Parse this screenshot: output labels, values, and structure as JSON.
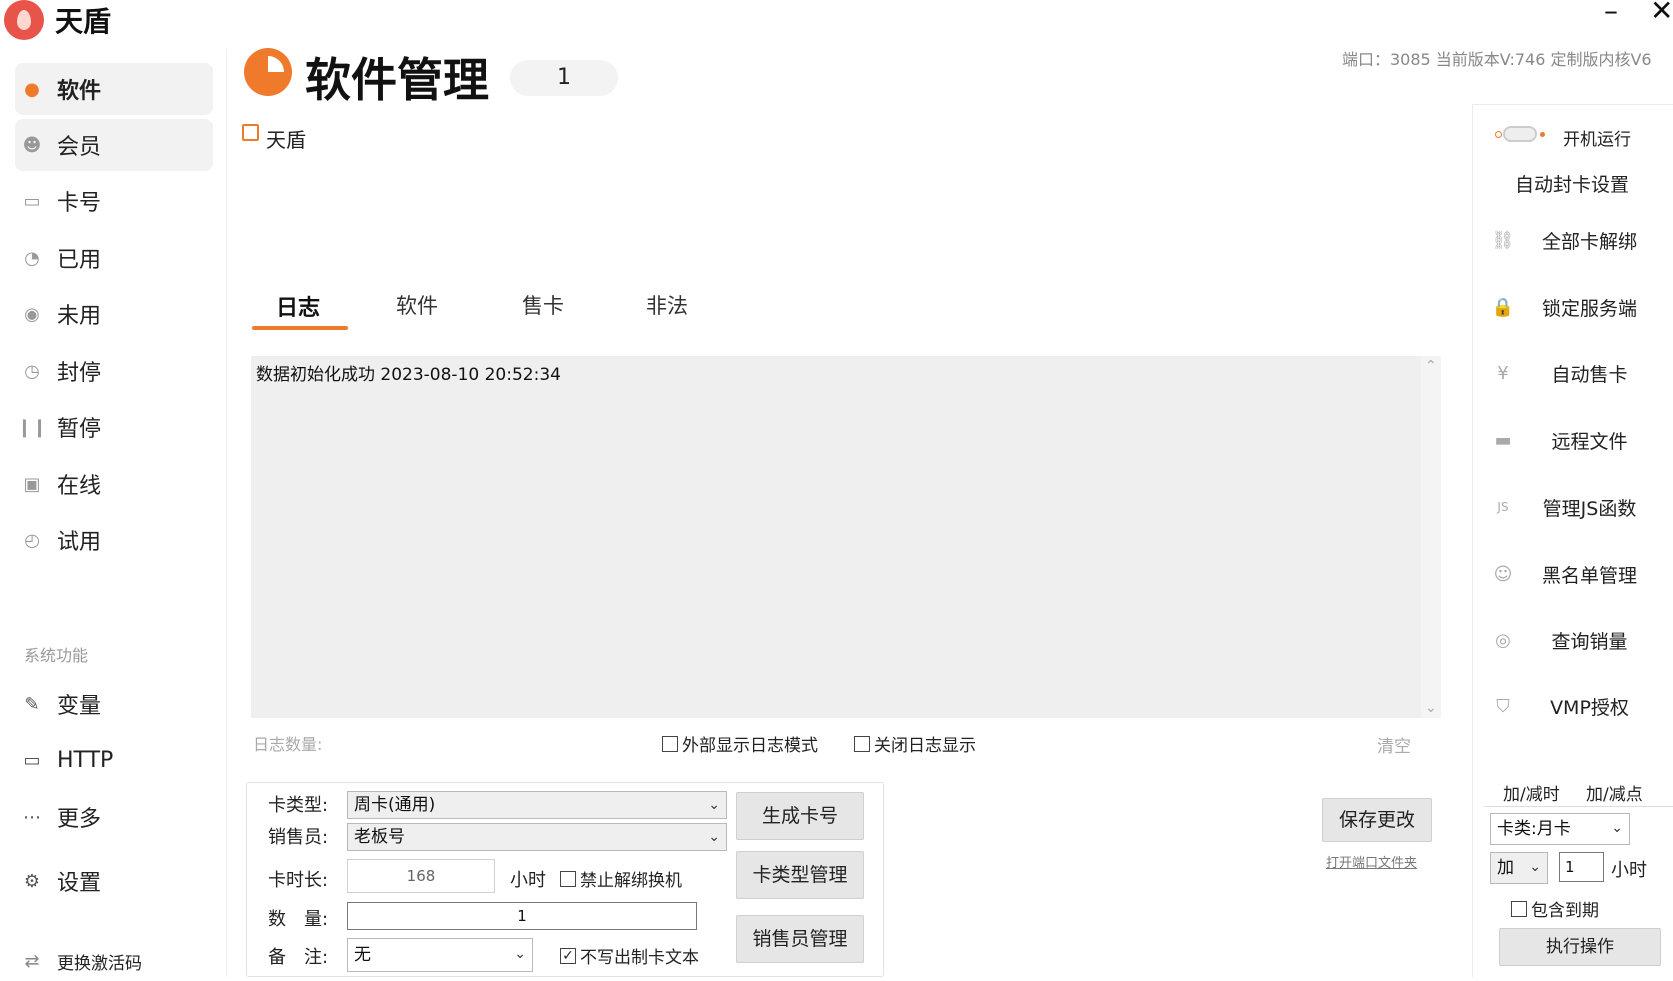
{
  "app": {
    "title": "天盾"
  },
  "window": {
    "minimize": "–",
    "close": "✕"
  },
  "sidebar": {
    "items": [
      {
        "label": "软件",
        "icon": "software-icon"
      },
      {
        "label": "会员",
        "icon": "member-icon"
      },
      {
        "label": "卡号",
        "icon": "card-icon"
      },
      {
        "label": "已用",
        "icon": "used-icon"
      },
      {
        "label": "未用",
        "icon": "unused-icon"
      },
      {
        "label": "封停",
        "icon": "banned-icon"
      },
      {
        "label": "暂停",
        "icon": "pause-icon"
      },
      {
        "label": "在线",
        "icon": "online-icon"
      },
      {
        "label": "试用",
        "icon": "trial-icon"
      }
    ],
    "section_label": "系统功能",
    "system_items": [
      {
        "label": "变量",
        "icon": "edit-icon"
      },
      {
        "label": "HTTP",
        "icon": "monitor-icon"
      },
      {
        "label": "更多",
        "icon": "more-icon"
      },
      {
        "label": "设置",
        "icon": "gear-icon"
      }
    ],
    "footer_link": "更换激活码"
  },
  "header": {
    "title": "软件管理",
    "count": "1",
    "info": "端口：3085  当前版本V:746 定制版内核V6",
    "breadcrumb": "天盾"
  },
  "tabs": [
    "日志",
    "软件",
    "售卡",
    "非法"
  ],
  "log": {
    "lines": [
      "数据初始化成功  2023-08-10 20:52:34"
    ],
    "count_label": "日志数量:",
    "external_mode_label": "外部显示日志模式",
    "close_log_label": "关闭日志显示",
    "clear_label": "清空"
  },
  "card_form": {
    "type_label": "卡类型:",
    "type_value": "周卡(通用)",
    "seller_label": "销售员:",
    "seller_value": "老板号",
    "duration_label": "卡时长:",
    "duration_value": "168",
    "duration_unit": "小时",
    "forbid_unbind_label": "禁止解绑换机",
    "quantity_label": "数　量:",
    "quantity_value": "1",
    "note_label": "备　注:",
    "note_value": "无",
    "no_write_label": "不写出制卡文本",
    "no_write_checked": true,
    "generate_btn": "生成卡号",
    "type_manage_btn": "卡类型管理",
    "seller_manage_btn": "销售员管理"
  },
  "save": {
    "button": "保存更改",
    "open_port_link": "打开端口文件夹"
  },
  "right_panel": {
    "startup_label": "开机运行",
    "auto_ban_label": "自动封卡设置",
    "items": [
      {
        "label": "全部卡解绑",
        "icon": "unlink-icon",
        "glyph": "⛓"
      },
      {
        "label": "锁定服务端",
        "icon": "lock-icon",
        "glyph": "🔒"
      },
      {
        "label": "自动售卡",
        "icon": "yen-icon",
        "glyph": "¥"
      },
      {
        "label": "远程文件",
        "icon": "folder-icon",
        "glyph": "▬"
      },
      {
        "label": "管理JS函数",
        "icon": "js-icon",
        "glyph": "JS"
      },
      {
        "label": "黑名单管理",
        "icon": "user-block-icon",
        "glyph": "☺"
      },
      {
        "label": "查询销量",
        "icon": "query-icon",
        "glyph": "◎"
      },
      {
        "label": "VMP授权",
        "icon": "shield-icon",
        "glyph": "⛉"
      }
    ],
    "tabs": [
      "加/减时",
      "加/减点"
    ],
    "card_type_value": "卡类:月卡",
    "op_value": "加",
    "amount_value": "1",
    "amount_unit": "小时",
    "include_expired_label": "包含到期",
    "execute_btn": "执行操作"
  }
}
